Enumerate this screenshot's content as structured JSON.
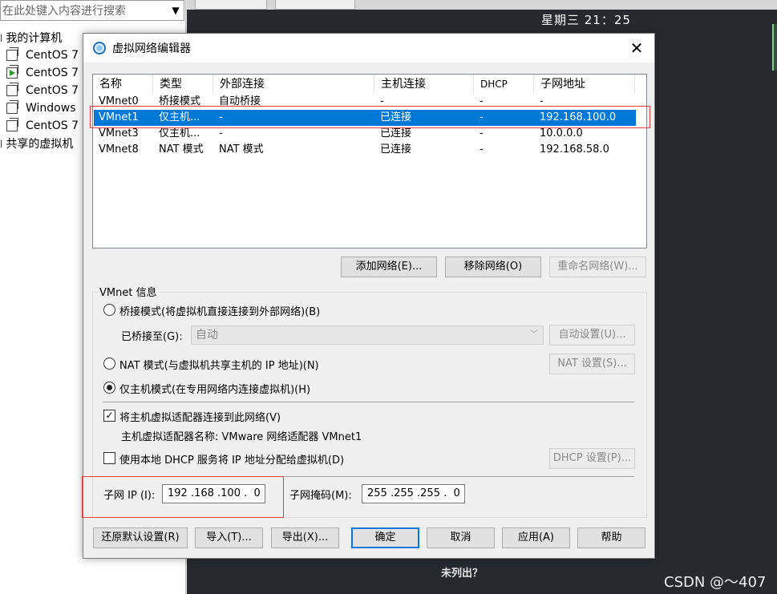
{
  "background": {
    "search_placeholder": "在此处键入内容进行搜索",
    "my_computer": "我的计算机",
    "vms": [
      {
        "name": "CentOS 7",
        "running": false
      },
      {
        "name": "CentOS 7",
        "running": true
      },
      {
        "name": "CentOS 7",
        "running": false
      },
      {
        "name": "Windows",
        "running": false
      },
      {
        "name": "CentOS 7",
        "running": false
      }
    ],
    "shared_vms": "共享的虚拟机",
    "clock": "星期三  21：25",
    "not_listed": "未列出？",
    "watermark": "CSDN @～407"
  },
  "dialog": {
    "title": "虚拟网络编辑器",
    "close_glyph": "✕",
    "columns": [
      "名称",
      "类型",
      "外部连接",
      "主机连接",
      "DHCP",
      "子网地址"
    ],
    "rows": [
      {
        "name": "VMnet0",
        "type": "桥接模式",
        "external": "自动桥接",
        "host": "-",
        "dhcp": "-",
        "subnet": "-",
        "selected": false
      },
      {
        "name": "VMnet1",
        "type": "仅主机...",
        "external": "-",
        "host": "已连接",
        "dhcp": "-",
        "subnet": "192.168.100.0",
        "selected": true
      },
      {
        "name": "VMnet3",
        "type": "仅主机...",
        "external": "-",
        "host": "已连接",
        "dhcp": "-",
        "subnet": "10.0.0.0",
        "selected": false
      },
      {
        "name": "VMnet8",
        "type": "NAT 模式",
        "external": "NAT 模式",
        "host": "已连接",
        "dhcp": "-",
        "subnet": "192.168.58.0",
        "selected": false
      }
    ],
    "add_network": "添加网络(E)...",
    "remove_network": "移除网络(O)",
    "rename_network": "重命名网络(W)...",
    "vmnet_info": "VMnet 信息",
    "bridged_mode": "桥接模式(将虚拟机直接连接到外部网络)(B)",
    "bridged_to_label": "已桥接至(G):",
    "bridged_to_value": "自动",
    "auto_settings": "自动设置(U)...",
    "nat_mode": "NAT 模式(与虚拟机共享主机的 IP 地址)(N)",
    "nat_settings": "NAT 设置(S)...",
    "host_only_mode": "仅主机模式(在专用网络内连接虚拟机)(H)",
    "selected_mode": "host_only",
    "connect_adapter": "将主机虚拟适配器连接到此网络(V)",
    "connect_adapter_checked": true,
    "adapter_name": "主机虚拟适配器名称: VMware 网络适配器 VMnet1",
    "use_dhcp": "使用本地 DHCP 服务将 IP 地址分配给虚拟机(D)",
    "use_dhcp_checked": false,
    "dhcp_settings": "DHCP 设置(P)...",
    "subnet_ip_label": "子网 IP (I):",
    "subnet_ip": "192 .168 .100 .  0",
    "subnet_mask_label": "子网掩码(M):",
    "subnet_mask": "255 .255 .255 .  0",
    "restore_defaults": "还原默认设置(R)",
    "import": "导入(T)...",
    "export": "导出(X)...",
    "ok": "确定",
    "cancel": "取消",
    "apply": "应用(A)",
    "help": "帮助",
    "check_glyph": "✓"
  }
}
